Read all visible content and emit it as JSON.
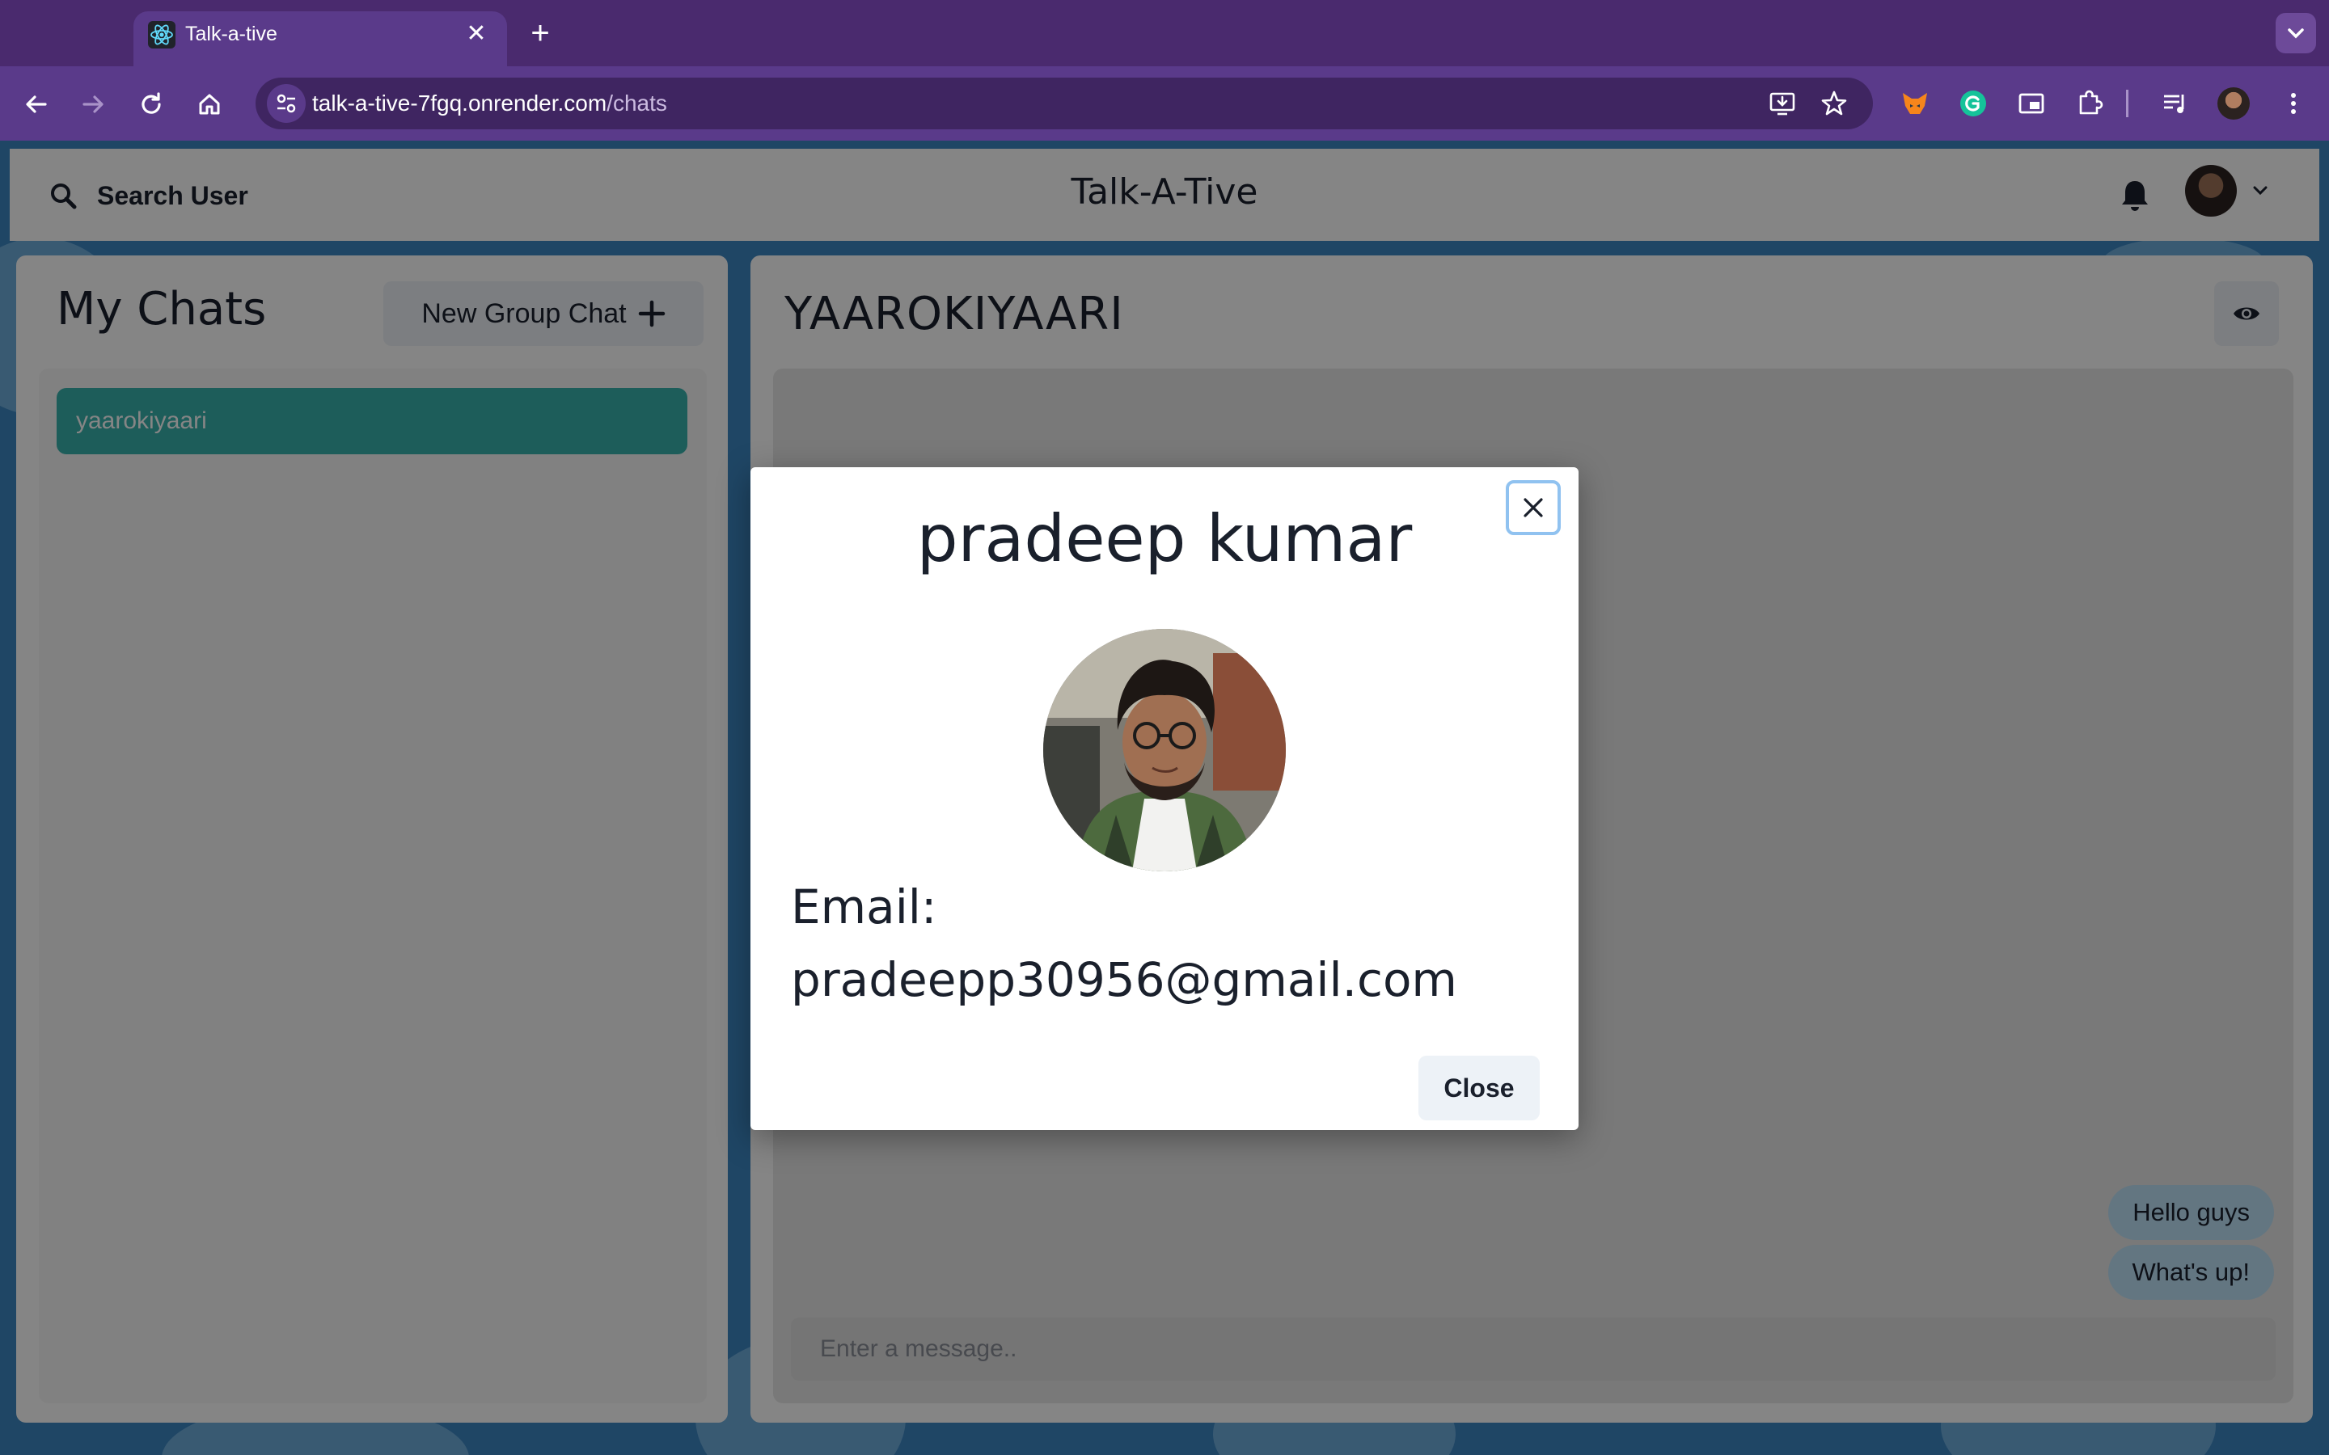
{
  "browser": {
    "tab_title": "Talk-a-tive",
    "url_host": "talk-a-tive-7fgq.onrender.com",
    "url_path": "/chats",
    "tab_close_glyph": "✕",
    "new_tab_glyph": "+",
    "favicon": "react-atom-icon"
  },
  "header": {
    "search_label": "Search User",
    "app_title": "Talk-A-Tive"
  },
  "sidebar": {
    "title": "My Chats",
    "new_group_label": "New Group Chat",
    "chats": [
      {
        "name": "yaarokiyaari",
        "selected": true
      }
    ]
  },
  "chat": {
    "title": "YAAROKIYAARI",
    "messages": [
      {
        "text": "Hello guys"
      },
      {
        "text": "What's up!"
      }
    ],
    "input_placeholder": "Enter a message.."
  },
  "modal": {
    "name": "pradeep kumar",
    "email_label": "Email:",
    "email": "pradeepp30956@gmail.com",
    "close_label": "Close"
  },
  "colors": {
    "chrome_tabbar": "#4a2a6e",
    "chrome_toolbar": "#5a3a8a",
    "selected_chat": "#38b2ac",
    "message_bubble": "#bee3f8",
    "page_background": "#3c86c2"
  }
}
